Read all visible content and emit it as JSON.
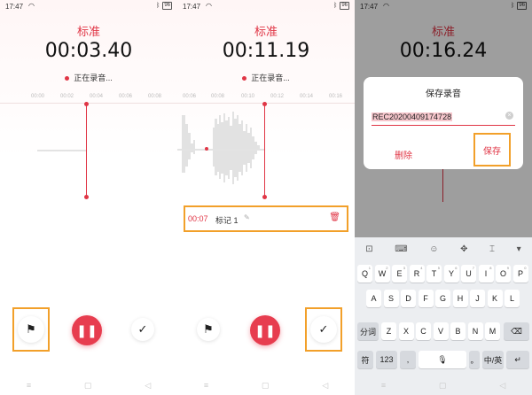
{
  "status_time": "17:47",
  "battery": "96",
  "mode_title": "标准",
  "panel1": {
    "timer": "00:03.40",
    "recording_label": "正在录音...",
    "ticks": [
      "00:00",
      "00:02",
      "00:04",
      "00:06",
      "00:08"
    ]
  },
  "panel2": {
    "timer": "00:11.19",
    "recording_label": "正在录音...",
    "ticks": [
      "00:06",
      "00:08",
      "00:10",
      "00:12",
      "00:14",
      "00:16"
    ],
    "mark": {
      "time": "00:07",
      "name": "标记 1"
    }
  },
  "panel3": {
    "timer": "00:16.24",
    "dialog": {
      "title": "保存录音",
      "filename": "REC20200409174728",
      "delete_label": "删除",
      "save_label": "保存"
    },
    "keyboard": {
      "row1": [
        "Q",
        "W",
        "E",
        "R",
        "T",
        "Y",
        "U",
        "I",
        "O",
        "P"
      ],
      "row1_sub": [
        "1",
        "2",
        "3",
        "4",
        "5",
        "6",
        "7",
        "8",
        "9",
        "0"
      ],
      "row2": [
        "A",
        "S",
        "D",
        "F",
        "G",
        "H",
        "J",
        "K",
        "L"
      ],
      "row3_fn": "分词",
      "row3": [
        "Z",
        "X",
        "C",
        "V",
        "B",
        "N",
        "M"
      ],
      "row4_sym": "符",
      "row4_num": "123",
      "row4_lang": "中/英"
    }
  },
  "colors": {
    "accent": "#e03545",
    "highlight": "#f2a02a"
  }
}
